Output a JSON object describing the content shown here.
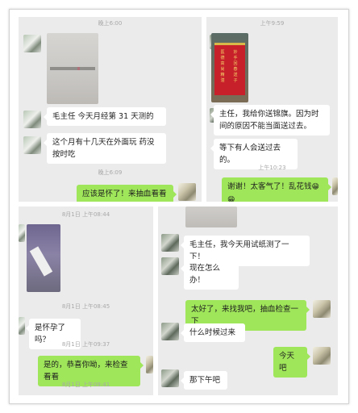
{
  "panel1": {
    "time_1": "晚上6:00",
    "msg_1": "毛主任 今天月经第 31 天测的",
    "msg_2": "这个月有十几天在外面玩 药没按时吃",
    "time_2": "晚上6:09",
    "reply_1": "应该是怀了！来抽血看看"
  },
  "panel2": {
    "time_1": "上午9:59",
    "banner_left": "医德高尚精湛",
    "banner_right": "妙手回春送子",
    "msg_1": "主任，我给你送锦旗。因为时间的原因不能当面送过去。",
    "msg_2": "等下有人会送过去的。",
    "time_2": "上午10:23",
    "reply_1": "谢谢！太客气了！乱花钱",
    "reply_emoji": "😁😁"
  },
  "panel3": {
    "time_1": "8月1日 上午08:44",
    "time_2": "8月1日 上午08:45",
    "msg_1": "是怀孕了吗？",
    "time_3": "8月1日 上午09:37",
    "reply_1": "是的，恭喜你呦，来检查看看",
    "time_4": "8月1日 上午09:41"
  },
  "panel4": {
    "msg_1": "毛主任，我今天用试纸测了一下！",
    "msg_2": "现在怎么办！",
    "reply_1": "太好了，来找我吧，抽血检查一下",
    "msg_3": "什么时候过来",
    "reply_2": "今天吧",
    "msg_4": "那下午吧"
  }
}
